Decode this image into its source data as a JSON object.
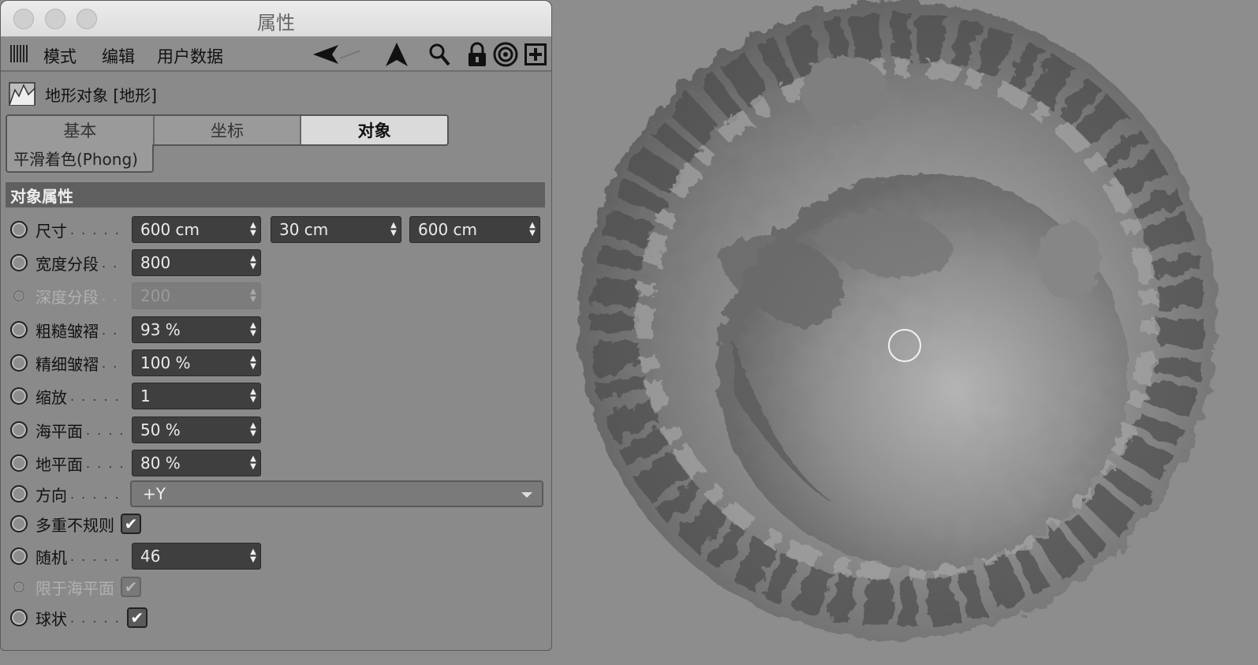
{
  "window": {
    "title": "属性"
  },
  "menu": {
    "items": [
      "模式",
      "编辑",
      "用户数据"
    ]
  },
  "object": {
    "header": "地形对象 [地形]"
  },
  "tabs": [
    {
      "label": "基本"
    },
    {
      "label": "坐标"
    },
    {
      "label": "对象",
      "active": true
    }
  ],
  "subtab": {
    "label": "平滑着色(Phong)"
  },
  "section": {
    "title": "对象属性"
  },
  "properties": {
    "size": {
      "label": "尺寸",
      "dots": ". . . . .",
      "x": "600 cm",
      "y": "30 cm",
      "z": "600 cm"
    },
    "width_segments": {
      "label": "宽度分段",
      "dots": ". .",
      "value": "800"
    },
    "depth_segments": {
      "label": "深度分段",
      "dots": ". .",
      "value": "200",
      "disabled": true
    },
    "rough_wrinkles": {
      "label": "粗糙皱褶",
      "dots": ". .",
      "value": "93 %"
    },
    "fine_wrinkles": {
      "label": "精细皱褶",
      "dots": ". .",
      "value": "100 %"
    },
    "scale": {
      "label": "缩放",
      "dots": ". . . . .",
      "value": "1"
    },
    "sea_level": {
      "label": "海平面",
      "dots": ". . . .",
      "value": "50 %"
    },
    "ground_level": {
      "label": "地平面",
      "dots": ". . . .",
      "value": "80 %"
    },
    "orientation": {
      "label": "方向",
      "dots": ". . . . .",
      "value": "+Y"
    },
    "multifractal": {
      "label": "多重不规则",
      "checked": true
    },
    "seed": {
      "label": "随机",
      "dots": ". . . . .",
      "value": "46"
    },
    "limit_to_sea_level": {
      "label": "限于海平面",
      "checked": true,
      "disabled": true
    },
    "spherical": {
      "label": "球状",
      "dots": ". . . . .",
      "checked": true
    }
  },
  "colors": {
    "field_bg": "#3f3f3f",
    "section_bg": "#5f5f5f",
    "active_tab": "#dadada"
  }
}
